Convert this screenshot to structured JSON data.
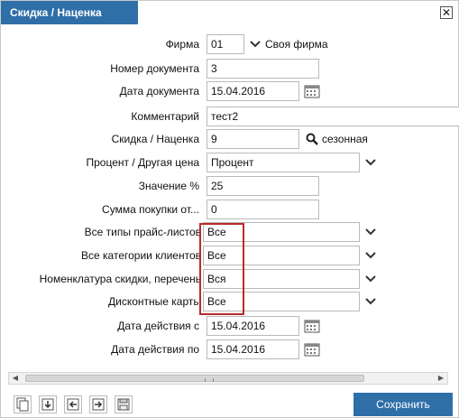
{
  "dialog": {
    "title": "Скидка / Наценка",
    "close_icon": "close-icon"
  },
  "form": {
    "firma": {
      "label": "Фирма",
      "code": "01",
      "name": "Своя фирма"
    },
    "doc_number": {
      "label": "Номер документа",
      "value": "3"
    },
    "doc_date": {
      "label": "Дата документа",
      "value": "15.04.2016"
    },
    "comment": {
      "label": "Комментарий",
      "value": "тест2"
    },
    "discount": {
      "label": "Скидка / Наценка",
      "value": "9",
      "type_text": "сезонная"
    },
    "percent_price": {
      "label": "Процент / Другая цена",
      "value": "Процент"
    },
    "value_pct": {
      "label": "Значение %",
      "value": "25"
    },
    "purchase_sum": {
      "label": "Сумма покупки от...",
      "value": "0"
    },
    "price_types": {
      "label": "Все типы прайс-листов",
      "value": "Все"
    },
    "client_categories": {
      "label": "Все категории клиентов",
      "value": "Все"
    },
    "nomenclature": {
      "label": "Номенклатура скидки, перечень",
      "value": "Вся"
    },
    "discount_cards": {
      "label": "Дисконтные карты",
      "value": "Все"
    },
    "date_from": {
      "label": "Дата действия с",
      "value": "15.04.2016"
    },
    "date_to": {
      "label": "Дата действия по",
      "value": "15.04.2016"
    }
  },
  "footer": {
    "save_label": "Сохранить"
  },
  "colors": {
    "accent": "#2f6fa8",
    "highlight": "#b92b2b"
  }
}
